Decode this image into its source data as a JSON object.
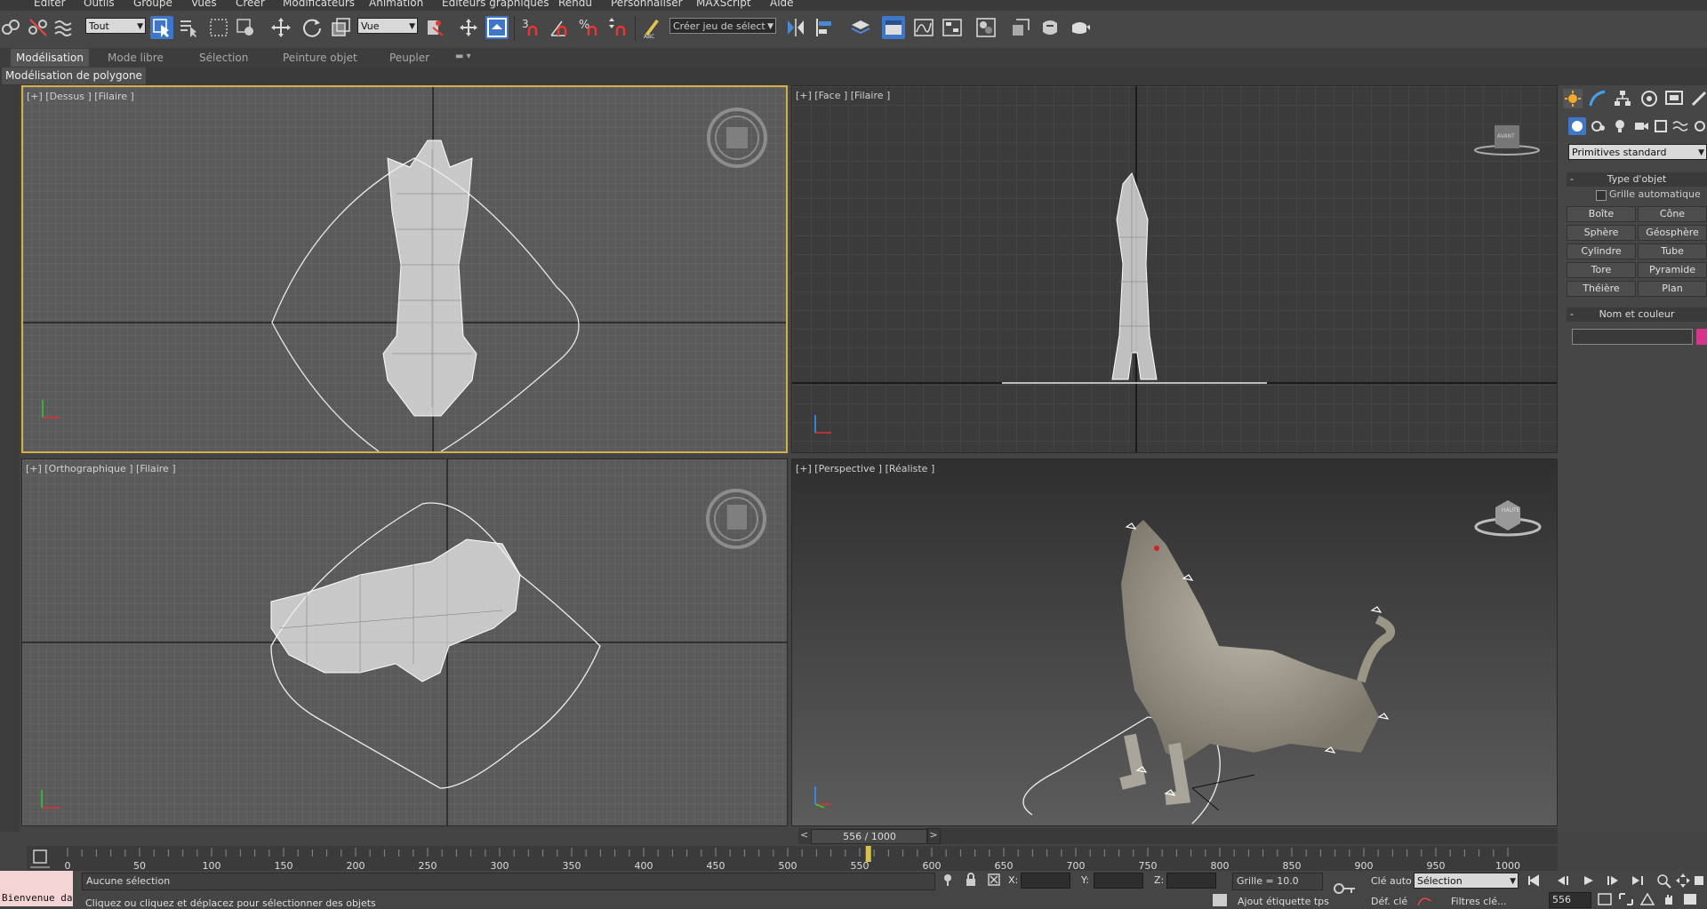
{
  "menu": {
    "items": [
      "Editer",
      "Outils",
      "Groupe",
      "Vues",
      "Créer",
      "Modificateurs",
      "Animation",
      "Editeurs graphiques",
      "Rendu",
      "Personnaliser",
      "MAXScript",
      "Aide"
    ]
  },
  "toolbar": {
    "filter_value": "Tout",
    "ref_coord_value": "Vue",
    "snap_labels": [
      "3n",
      "%n"
    ],
    "named_selection_value": "Créer jeu de sélect"
  },
  "ribbon": {
    "tabs": [
      "Modélisation",
      "Mode libre",
      "Sélection",
      "Peinture objet",
      "Peupler"
    ],
    "sub_label": "Modélisation de polygone"
  },
  "viewports": {
    "top_label": "[+] [Dessus ] [Filaire ]",
    "front_label": "[+] [Face ] [Filaire ]",
    "ortho_label": "[+] [Orthographique ] [Filaire ]",
    "persp_label": "[+] [Perspective ] [Réaliste ]",
    "viewcube_front": "AVANT",
    "viewcube_persp": "HAUTE"
  },
  "command_panel": {
    "dropdown": "Primitives standard",
    "object_type_title": "Type d'objet",
    "autogrid_label": "Grille automatique",
    "buttons": [
      "Boîte",
      "Cône",
      "Sphère",
      "Géosphère",
      "Cylindre",
      "Tube",
      "Tore",
      "Pyramide",
      "Théière",
      "Plan"
    ],
    "name_color_title": "Nom et couleur",
    "color_swatch": "#d6368a"
  },
  "timeline": {
    "current_frame_label": "556 / 1000",
    "current_frame": 556,
    "total_frames": 1000,
    "ticks": [
      "0",
      "50",
      "100",
      "150",
      "200",
      "250",
      "300",
      "350",
      "400",
      "450",
      "500",
      "550",
      "600",
      "650",
      "700",
      "750",
      "800",
      "850",
      "900",
      "950",
      "1000"
    ]
  },
  "status": {
    "selection_text": "Aucune sélection",
    "prompt_text": "Cliquez ou cliquez et déplacez pour sélectionner des objets",
    "listener_text": "Bienvenue da",
    "x_label": "X:",
    "y_label": "Y:",
    "z_label": "Z:",
    "grid_label": "Grille = 10.0",
    "auto_key_label": "Clé auto",
    "set_key_label": "Déf. clé",
    "selection_dropdown": "Sélection",
    "key_filters_label": "Filtres clé...",
    "add_time_tag": "Ajout étiquette tps",
    "frame_field": "556"
  },
  "colors": {
    "active_blue": "#3e77c7",
    "active_viewport_border": "#d3b04a",
    "timeslider_marker": "#d8c24a"
  }
}
